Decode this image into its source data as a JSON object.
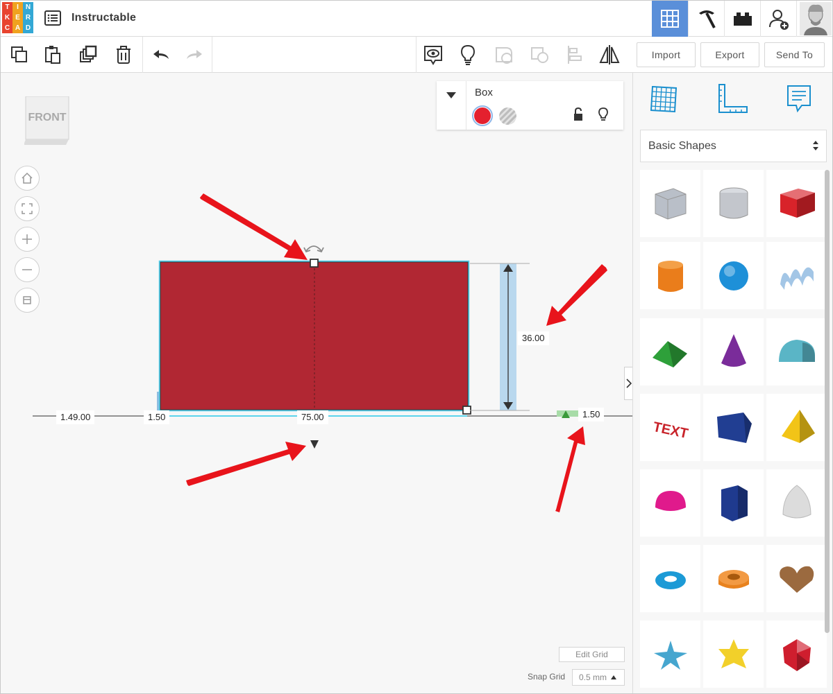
{
  "app": {
    "logo_letters": [
      "T",
      "I",
      "N",
      "K",
      "E",
      "R",
      "C",
      "A",
      "D"
    ],
    "logo_colors": [
      "#e8442f",
      "#f0a21f",
      "#33a8d5",
      "#e8442f",
      "#f0a21f",
      "#33a8d5",
      "#e8442f",
      "#f0a21f",
      "#33a8d5"
    ],
    "design_title": "Instructable",
    "accent_color": "#5a8fd9"
  },
  "toolbar": {
    "import_label": "Import",
    "export_label": "Export",
    "send_to_label": "Send To"
  },
  "viewcube": {
    "face_label": "FRONT"
  },
  "shape_props": {
    "title": "Box",
    "solid_color": "#e4202e"
  },
  "dimensions": {
    "height": "36.00",
    "width": "75.00",
    "left_offset": "1.49.00",
    "left_gap": "1.50",
    "right_elevation": "1.50"
  },
  "grid_controls": {
    "edit_grid_label": "Edit Grid",
    "snap_grid_label": "Snap Grid",
    "snap_grid_value": "0.5 mm"
  },
  "shapes_panel": {
    "category": "Basic Shapes",
    "shapes": [
      {
        "name": "box-hole",
        "color": "#b9bfc8"
      },
      {
        "name": "cylinder-hole",
        "color": "#c3c6cc"
      },
      {
        "name": "box",
        "color": "#d8232a"
      },
      {
        "name": "cylinder",
        "color": "#ea7d1b"
      },
      {
        "name": "sphere",
        "color": "#1e90d8"
      },
      {
        "name": "scribble",
        "color": "#a3c6e6"
      },
      {
        "name": "roof",
        "color": "#2ea03a"
      },
      {
        "name": "cone",
        "color": "#7a2c9a"
      },
      {
        "name": "round-roof",
        "color": "#5ab5c6"
      },
      {
        "name": "text",
        "color": "#c8232a"
      },
      {
        "name": "wedge",
        "color": "#213e92"
      },
      {
        "name": "pyramid",
        "color": "#f2c417"
      },
      {
        "name": "half-sphere",
        "color": "#e01a8c"
      },
      {
        "name": "polygon",
        "color": "#1f3a8e"
      },
      {
        "name": "paraboloid",
        "color": "#dcdcdc"
      },
      {
        "name": "torus",
        "color": "#1c9ad6"
      },
      {
        "name": "tube",
        "color": "#e8821e"
      },
      {
        "name": "heart",
        "color": "#9b6a3f"
      },
      {
        "name": "star",
        "color": "#46a6cf"
      },
      {
        "name": "star-six",
        "color": "#f2d02a"
      },
      {
        "name": "icosahedron",
        "color": "#cf1e2e"
      }
    ]
  }
}
